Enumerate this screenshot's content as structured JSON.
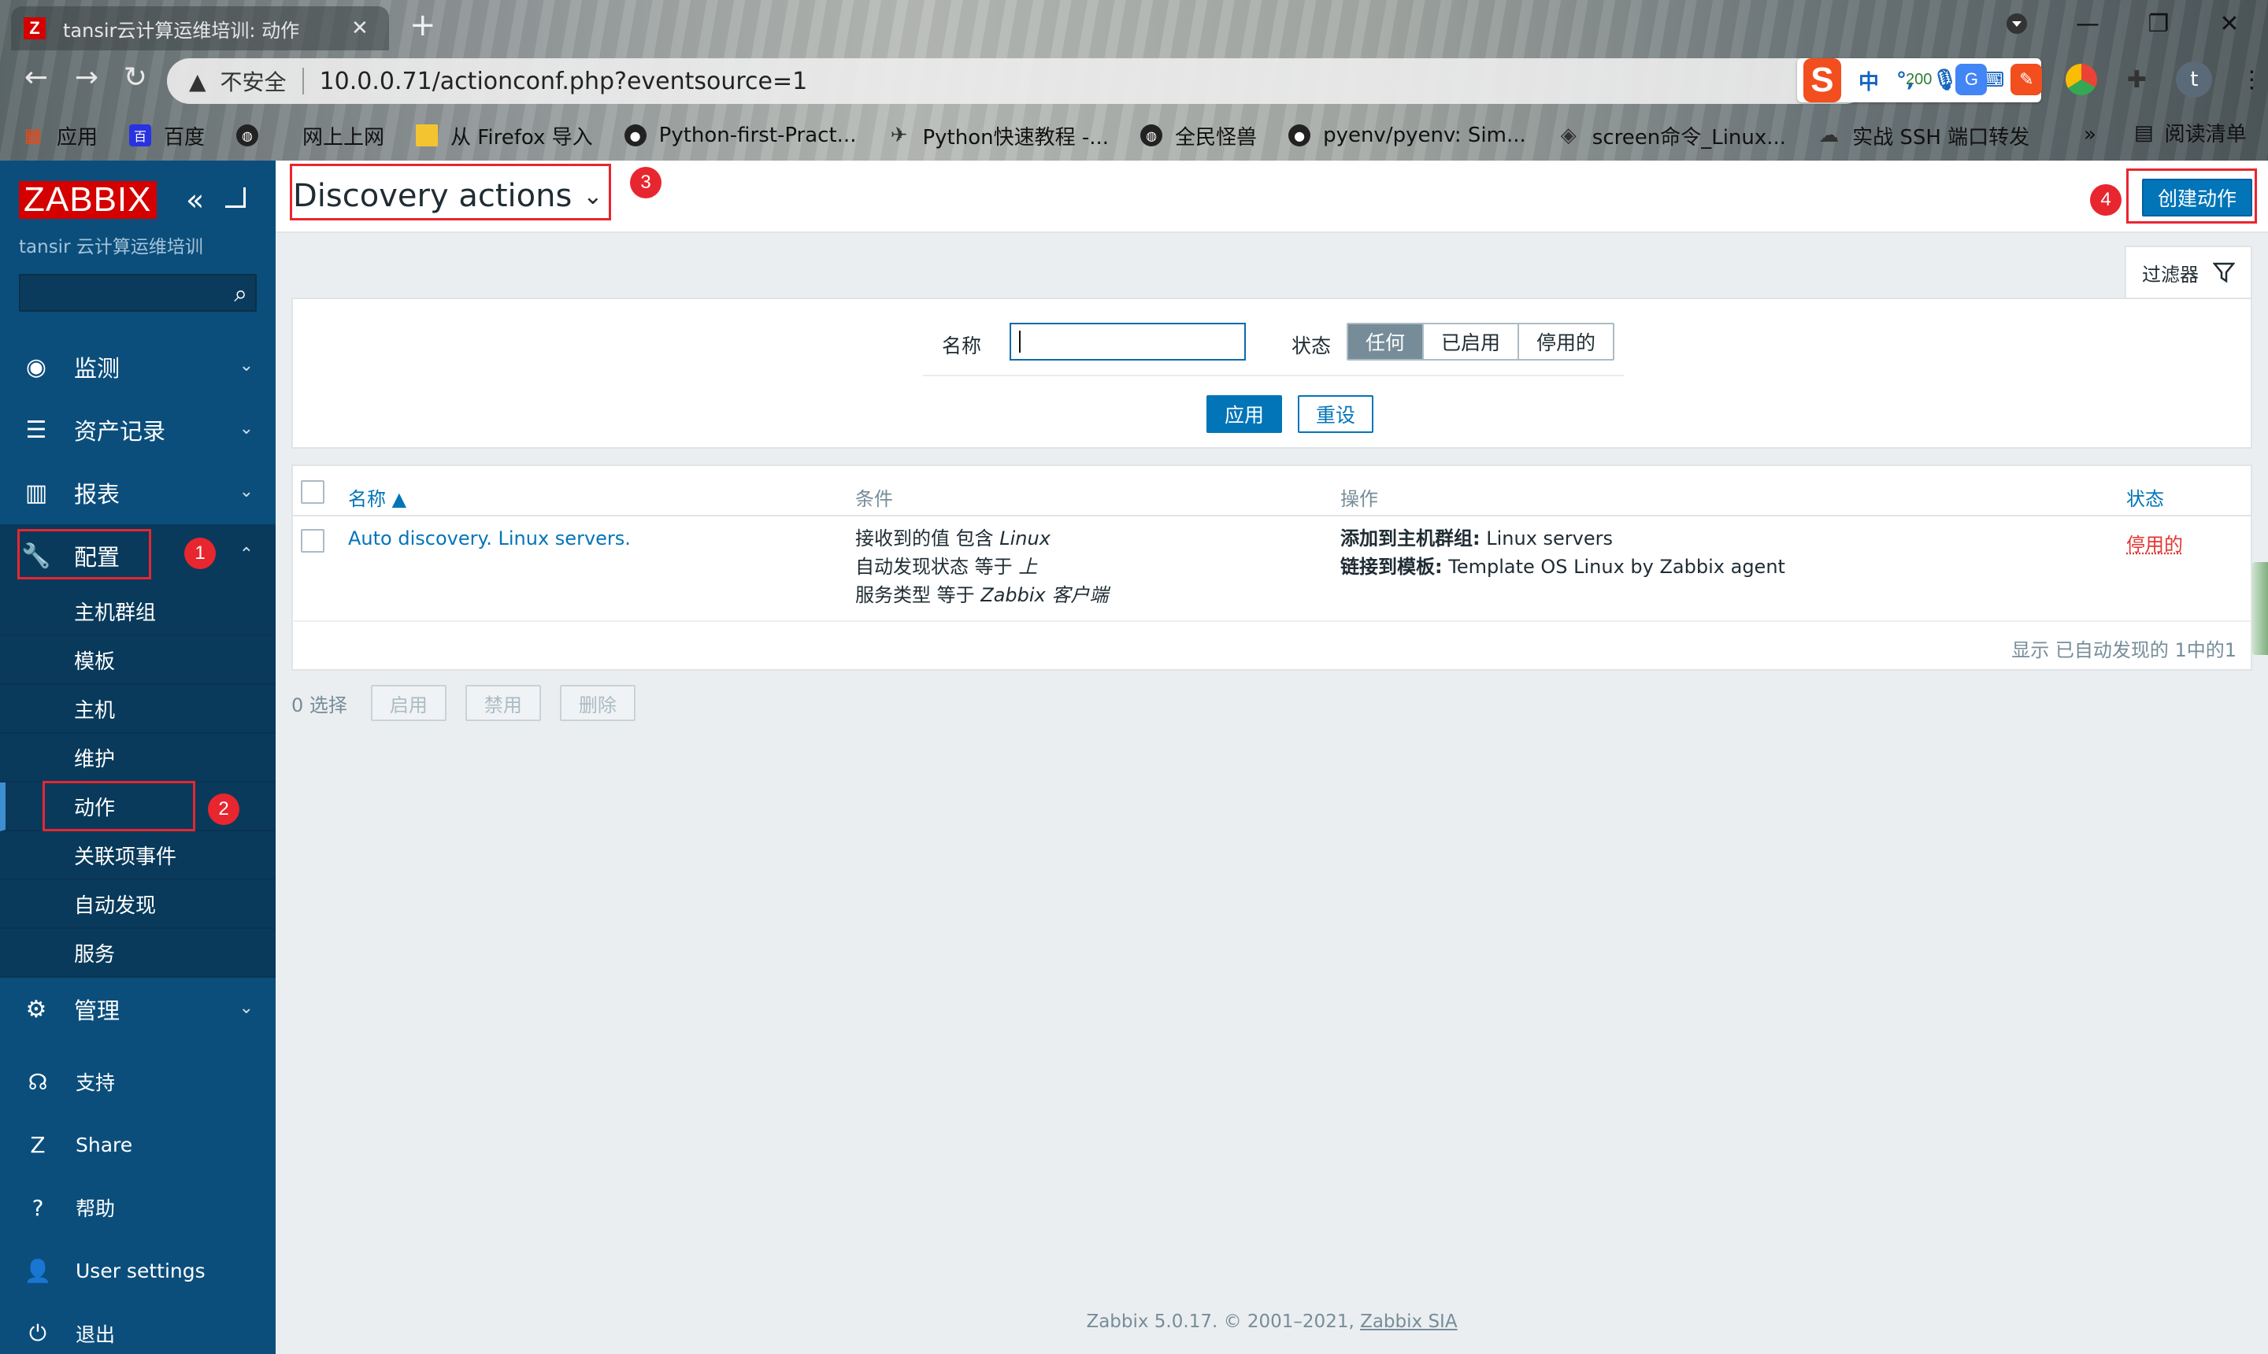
{
  "browser": {
    "tab_title": "tansir云计算运维培训: 动作",
    "favicon_letter": "Z",
    "address_security": "不安全",
    "address_url": "10.0.0.71/actionconf.php?eventsource=1",
    "ext_badge": "200",
    "avatar_letter": "t",
    "bookmarks": [
      "应用",
      "百度",
      "",
      "网上上网",
      "从 Firefox 导入",
      "Python-first-Pract...",
      "Python快速教程 -...",
      "全民怪兽",
      "pyenv/pyenv: Sim...",
      "screen命令_Linux...",
      "实战 SSH 端口转发"
    ],
    "bookmarks_more": "»",
    "reading_list": "阅读清单"
  },
  "sidebar": {
    "logo": "ZABBIX",
    "sub_brand": "tansir 云计算运维培训",
    "menu": [
      {
        "label": "监测"
      },
      {
        "label": "资产记录"
      },
      {
        "label": "报表"
      },
      {
        "label": "配置"
      }
    ],
    "config_items": [
      "主机群组",
      "模板",
      "主机",
      "维护",
      "动作",
      "关联项事件",
      "自动发现",
      "服务"
    ],
    "admin_label": "管理",
    "bottom": [
      "支持",
      "Share",
      "帮助",
      "User settings",
      "退出"
    ]
  },
  "annotations": [
    "1",
    "2",
    "3",
    "4"
  ],
  "header": {
    "title": "Discovery actions",
    "create_button": "创建动作"
  },
  "filter": {
    "tab_label": "过滤器",
    "name_label": "名称",
    "name_value": "",
    "status_label": "状态",
    "status_options": [
      "任何",
      "已启用",
      "停用的"
    ],
    "apply": "应用",
    "reset": "重设"
  },
  "table": {
    "columns": [
      "名称 ▲",
      "条件",
      "操作",
      "状态"
    ],
    "rows": [
      {
        "name": "Auto discovery. Linux servers.",
        "conditions": [
          {
            "text": "接收到的值 包含 ",
            "value": "Linux"
          },
          {
            "text": "自动发现状态 等于 ",
            "value": "上"
          },
          {
            "text": "服务类型 等于 ",
            "value": "Zabbix 客户端"
          }
        ],
        "operations": [
          {
            "label": "添加到主机群组:",
            "value": " Linux servers"
          },
          {
            "label": "链接到模板:",
            "value": " Template OS Linux by Zabbix agent"
          }
        ],
        "status": "停用的"
      }
    ],
    "footer": "显示 已自动发现的 1中的1"
  },
  "bulk": {
    "selected": "0 选择",
    "buttons": [
      "启用",
      "禁用",
      "删除"
    ]
  },
  "footer": {
    "text": "Zabbix 5.0.17. © 2001–2021,",
    "link": "Zabbix SIA"
  }
}
